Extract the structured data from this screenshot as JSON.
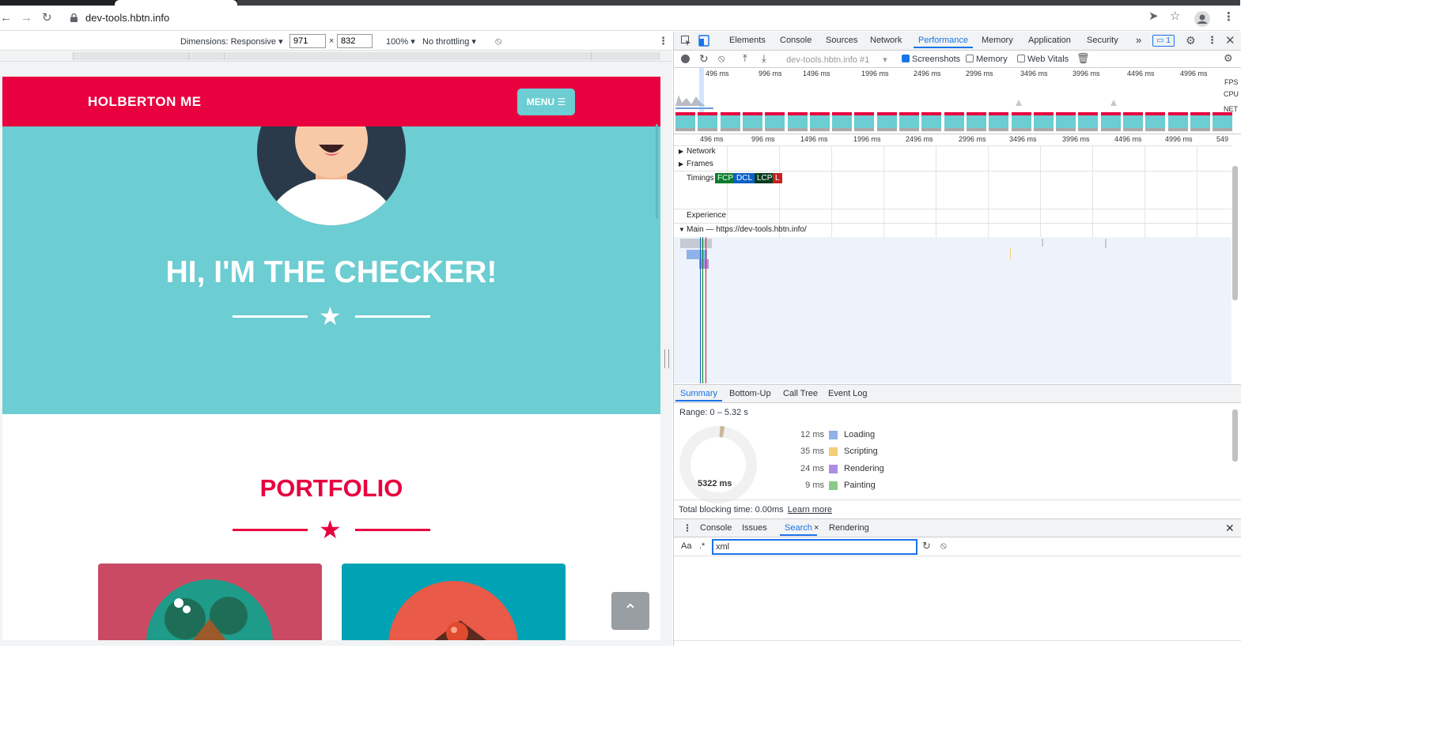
{
  "browser": {
    "url": "dev-tools.hbtn.info"
  },
  "device_toolbar": {
    "dimensions_label": "Dimensions: Responsive",
    "width": "971",
    "times": "×",
    "height": "832",
    "zoom": "100%",
    "throttling": "No throttling"
  },
  "page": {
    "brand": "HOLBERTON ME",
    "menu_label": "MENU",
    "hero_title": "HI, I'M THE CHECKER!",
    "portfolio_title": "PORTFOLIO",
    "colors": {
      "primary": "#e8003f",
      "teal": "#6ccdd2",
      "card1": "#c94a62",
      "card2": "#00a3b4"
    }
  },
  "devtools": {
    "tabs": [
      "Elements",
      "Console",
      "Sources",
      "Network",
      "Performance",
      "Memory",
      "Application",
      "Security"
    ],
    "active_tab": "Performance",
    "more": "»",
    "issues_count": "1",
    "recording": "dev-tools.hbtn.info #1",
    "checkboxes": [
      {
        "label": "Screenshots",
        "checked": true
      },
      {
        "label": "Memory",
        "checked": false
      },
      {
        "label": "Web Vitals",
        "checked": false
      }
    ],
    "overview_ticks": [
      "496 ms",
      "996 ms",
      "1496 ms",
      "1996 ms",
      "2496 ms",
      "2996 ms",
      "3496 ms",
      "3996 ms",
      "4496 ms",
      "4996 ms"
    ],
    "overview_labels": [
      "FPS",
      "CPU",
      "NET"
    ],
    "timeline_ticks": [
      "496 ms",
      "996 ms",
      "1496 ms",
      "1996 ms",
      "2496 ms",
      "2996 ms",
      "3496 ms",
      "3996 ms",
      "4496 ms",
      "4996 ms",
      "549"
    ],
    "tracks": {
      "network": "Network",
      "frames": "Frames",
      "timings": "Timings",
      "experience": "Experience",
      "main": "Main — https://dev-tools.hbtn.info/"
    },
    "markers": [
      "FCP",
      "DCL",
      "LCP",
      "L"
    ],
    "summary_tabs": [
      "Summary",
      "Bottom-Up",
      "Call Tree",
      "Event Log"
    ],
    "range": "Range: 0 – 5.32 s",
    "total": "5322 ms",
    "categories": [
      {
        "ms": "12 ms",
        "name": "Loading",
        "color": "#8fb2e8"
      },
      {
        "ms": "35 ms",
        "name": "Scripting",
        "color": "#f2cd7a"
      },
      {
        "ms": "24 ms",
        "name": "Rendering",
        "color": "#ad8ee3"
      },
      {
        "ms": "9 ms",
        "name": "Painting",
        "color": "#8cc98a"
      }
    ],
    "tbt": "Total blocking time: 0.00ms",
    "learn_more": "Learn more",
    "drawer_tabs": [
      "Console",
      "Issues",
      "Search",
      "Rendering"
    ],
    "drawer_active": "Search",
    "search": {
      "case_label": "Aa",
      "regex_label": ".*",
      "value": "xml"
    }
  }
}
